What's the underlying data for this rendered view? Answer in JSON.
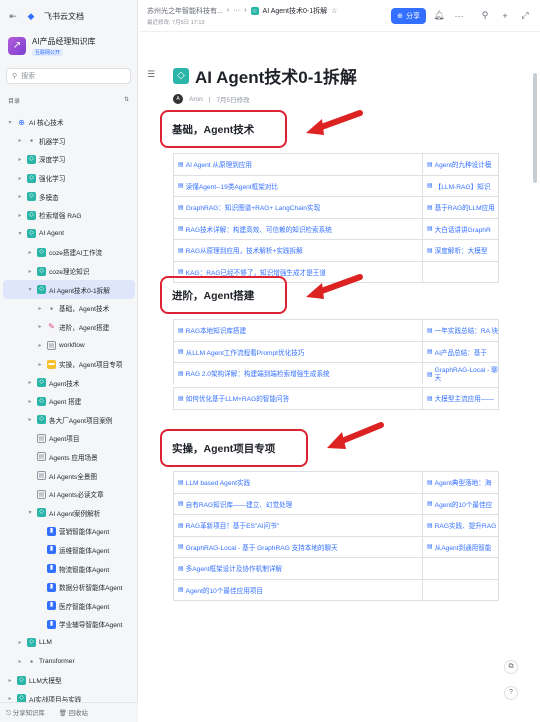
{
  "sidebar": {
    "brand": "飞书云文档",
    "kb_title": "AI产品经理知识库",
    "kb_tag": "互联网公开",
    "search_placeholder": "搜索",
    "dir_label": "目录",
    "tree": [
      {
        "label": "AI 核心技术",
        "indent": 0,
        "icon": "globe",
        "tw": "▾"
      },
      {
        "label": "机器学习",
        "indent": 1,
        "icon": "dark",
        "tw": "▸"
      },
      {
        "label": "深度学习",
        "indent": 1,
        "icon": "teal",
        "tw": "▸"
      },
      {
        "label": "强化学习",
        "indent": 1,
        "icon": "teal",
        "tw": "▸"
      },
      {
        "label": "多模态",
        "indent": 1,
        "icon": "teal",
        "tw": "▸"
      },
      {
        "label": "检索增强 RAG",
        "indent": 1,
        "icon": "teal",
        "tw": "▸"
      },
      {
        "label": "AI Agent",
        "indent": 1,
        "icon": "teal",
        "tw": "▾"
      },
      {
        "label": "coze搭建AI工作流",
        "indent": 2,
        "icon": "teal",
        "tw": "▸"
      },
      {
        "label": "coze理论知识",
        "indent": 2,
        "icon": "teal",
        "tw": "▸"
      },
      {
        "label": "AI Agent技术0-1拆解",
        "indent": 2,
        "icon": "teal",
        "tw": "▾",
        "active": true
      },
      {
        "label": "基础，Agent技术",
        "indent": 3,
        "icon": "dark",
        "tw": "▸"
      },
      {
        "label": "进阶，Agent搭建",
        "indent": 3,
        "icon": "pink",
        "tw": "▸"
      },
      {
        "label": "workflow",
        "indent": 3,
        "icon": "gray",
        "tw": "▸"
      },
      {
        "label": "实操，Agent项目专项",
        "indent": 3,
        "icon": "yellow",
        "tw": "▸"
      },
      {
        "label": "Agent技术",
        "indent": 2,
        "icon": "teal",
        "tw": "▸"
      },
      {
        "label": "Agent 搭建",
        "indent": 2,
        "icon": "teal",
        "tw": "▸"
      },
      {
        "label": "各大厂Agent项目案例",
        "indent": 2,
        "icon": "teal",
        "tw": "▸"
      },
      {
        "label": "Agent项目",
        "indent": 2,
        "icon": "gray",
        "tw": ""
      },
      {
        "label": "Agents 应用场景",
        "indent": 2,
        "icon": "gray",
        "tw": ""
      },
      {
        "label": "AI Agents全景图",
        "indent": 2,
        "icon": "gray",
        "tw": ""
      },
      {
        "label": "AI Agents必读文章",
        "indent": 2,
        "icon": "gray",
        "tw": ""
      },
      {
        "label": "AI Agent案例解析",
        "indent": 2,
        "icon": "teal",
        "tw": "▾"
      },
      {
        "label": "营销智能体Agent",
        "indent": 3,
        "icon": "blue",
        "tw": ""
      },
      {
        "label": "运维智能体Agent",
        "indent": 3,
        "icon": "blue",
        "tw": ""
      },
      {
        "label": "物流智能体Agent",
        "indent": 3,
        "icon": "blue",
        "tw": ""
      },
      {
        "label": "数据分析智能体Agent",
        "indent": 3,
        "icon": "blue",
        "tw": ""
      },
      {
        "label": "医疗智能体Agent",
        "indent": 3,
        "icon": "blue",
        "tw": ""
      },
      {
        "label": "学业辅导智能体Agent",
        "indent": 3,
        "icon": "blue",
        "tw": ""
      },
      {
        "label": "LLM",
        "indent": 1,
        "icon": "teal",
        "tw": "▸"
      },
      {
        "label": "Transformer",
        "indent": 1,
        "icon": "dark",
        "tw": "▸"
      },
      {
        "label": "LLM大模型",
        "indent": 0,
        "icon": "teal",
        "tw": "▸"
      },
      {
        "label": "AI实战项目与实践",
        "indent": 0,
        "icon": "teal",
        "tw": "▸"
      }
    ],
    "bottom_share": "分享知识库",
    "bottom_trash": "回收站"
  },
  "topbar": {
    "crumb_space": "苏州光之年智能科技有...",
    "crumb_ellipsis": "···",
    "crumb_current": "AI Agent技术0-1拆解",
    "edited": "最近修改: 7月5日 17:13",
    "share_label": "分享"
  },
  "doc": {
    "title": "AI Agent技术0-1拆解",
    "author": "Aron",
    "modified": "7月5日修改",
    "sections": [
      {
        "heading": "基础，Agent技术",
        "rows": [
          [
            "AI Agent 从原理到应用",
            "Agent的九种设计模"
          ],
          [
            "读懂Agent--19类Agent框架对比",
            "【LLM-RAG】知识"
          ],
          [
            "GraphRAG：知识图谱+RAG+ LangChain实现",
            "基于RAG的LLM应用"
          ],
          [
            "RAG技术详解：构建高效、可信赖的知识检索系统",
            "大白话讲讲GraphR"
          ],
          [
            "RAG从原理到应用，技术解析+实践拆解",
            "深度解析：大模型"
          ],
          [
            "KAG：RAG已经不够了，知识增强生成才是王道",
            ""
          ]
        ]
      },
      {
        "heading": "进阶，Agent搭建",
        "rows": [
          [
            "RAG本地知识库搭建",
            "一年实践总结：RA 块"
          ],
          [
            "从LLM Agent工作流程看Prompt优化技巧",
            "AI产品总结：基于"
          ],
          [
            "RAG 2.0架构详解：构建端到端检索增强生成系统",
            "GraphRAG-Local - 聊天"
          ],
          [
            "如何优化基于LLM+RAG的智能问答",
            "大模型主流应用——"
          ]
        ]
      },
      {
        "heading": "实操，Agent项目专项",
        "rows": [
          [
            "LLM based Agent实践",
            "Agent典型落地：海"
          ],
          [
            "自有RAG知识库——建立、幻觉处理",
            "Agent的10个最佳应"
          ],
          [
            "RAG革新项目！基于ES\"AI问书\"",
            "RAG实践、提升RAG"
          ],
          [
            "GraphRAG-Local - 基于 GraphRAG 支持本地的聊天",
            "从Agent到通用智能"
          ],
          [
            "多Agent框架设计及协作机制详解",
            ""
          ],
          [
            "Agent的10个最佳应用项目",
            ""
          ]
        ]
      }
    ]
  },
  "colors": {
    "accent": "#3370ff",
    "teal": "#2bb5a8",
    "annotation_red": "#dd2222"
  }
}
